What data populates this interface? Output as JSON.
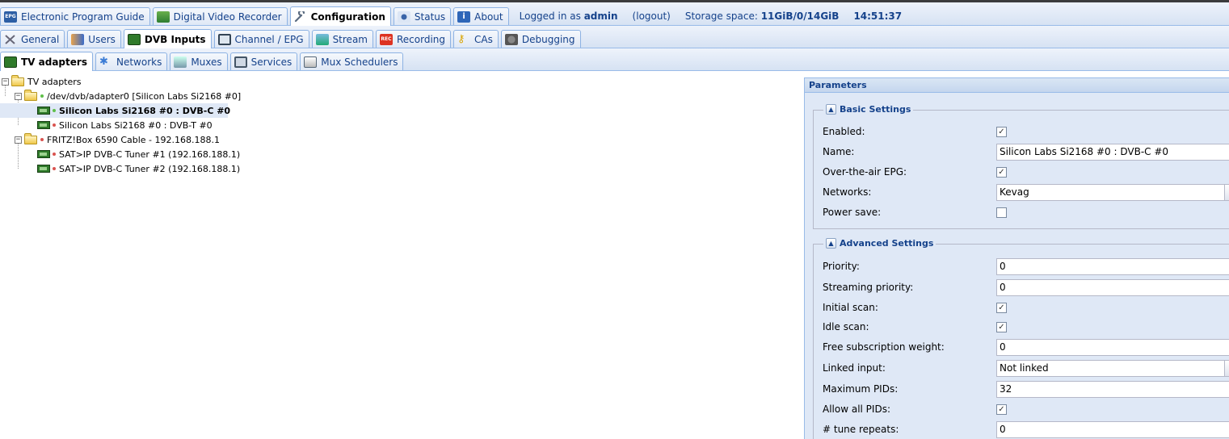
{
  "top_tabs": [
    {
      "label": "Electronic Program Guide",
      "icon": "epg-icon"
    },
    {
      "label": "Digital Video Recorder",
      "icon": "download-icon"
    },
    {
      "label": "Configuration",
      "icon": "wrench-icon",
      "active": true
    },
    {
      "label": "Status",
      "icon": "eye-icon"
    },
    {
      "label": "About",
      "icon": "info-icon"
    }
  ],
  "status": {
    "logged_in_prefix": "Logged in as",
    "user": "admin",
    "logout": "(logout)",
    "storage_label": "Storage space:",
    "storage_value": "11GiB/0/14GiB",
    "time": "14:51:37"
  },
  "config_tabs": [
    {
      "label": "General"
    },
    {
      "label": "Users"
    },
    {
      "label": "DVB Inputs",
      "active": true
    },
    {
      "label": "Channel / EPG"
    },
    {
      "label": "Stream"
    },
    {
      "label": "Recording"
    },
    {
      "label": "CAs"
    },
    {
      "label": "Debugging"
    }
  ],
  "dvb_tabs": [
    {
      "label": "TV adapters",
      "active": true
    },
    {
      "label": "Networks"
    },
    {
      "label": "Muxes"
    },
    {
      "label": "Services"
    },
    {
      "label": "Mux Schedulers"
    }
  ],
  "tree": {
    "root": "TV adapters",
    "adapter0": "/dev/dvb/adapter0 [Silicon Labs Si2168 #0]",
    "adapter0_dvbc": "Silicon Labs Si2168 #0 : DVB-C #0",
    "adapter0_dvbt": "Silicon Labs Si2168 #0 : DVB-T #0",
    "fritzbox": "FRITZ!Box 6590 Cable - 192.168.188.1",
    "tuner1": "SAT>IP DVB-C Tuner #1 (192.168.188.1)",
    "tuner2": "SAT>IP DVB-C Tuner #2 (192.168.188.1)"
  },
  "parameters": {
    "title": "Parameters",
    "basic": {
      "legend": "Basic Settings",
      "enabled_label": "Enabled:",
      "enabled": true,
      "name_label": "Name:",
      "name_value": "Silicon Labs Si2168 #0 : DVB-C #0",
      "ota_epg_label": "Over-the-air EPG:",
      "ota_epg": true,
      "networks_label": "Networks:",
      "networks_value": "Kevag",
      "power_save_label": "Power save:",
      "power_save": false
    },
    "advanced": {
      "legend": "Advanced Settings",
      "priority_label": "Priority:",
      "priority_value": "0",
      "streaming_priority_label": "Streaming priority:",
      "streaming_priority_value": "0",
      "initial_scan_label": "Initial scan:",
      "initial_scan": true,
      "idle_scan_label": "Idle scan:",
      "idle_scan": true,
      "free_sub_weight_label": "Free subscription weight:",
      "free_sub_weight_value": "0",
      "linked_input_label": "Linked input:",
      "linked_input_value": "Not linked",
      "max_pids_label": "Maximum PIDs:",
      "max_pids_value": "32",
      "allow_all_pids_label": "Allow all PIDs:",
      "allow_all_pids": true,
      "tune_repeats_label": "# tune repeats:",
      "tune_repeats_value": "0"
    }
  },
  "check_glyph": "✓",
  "colors": {
    "accent": "#15428b",
    "panel_bg": "#dfe8f6",
    "border": "#99bbe8"
  }
}
